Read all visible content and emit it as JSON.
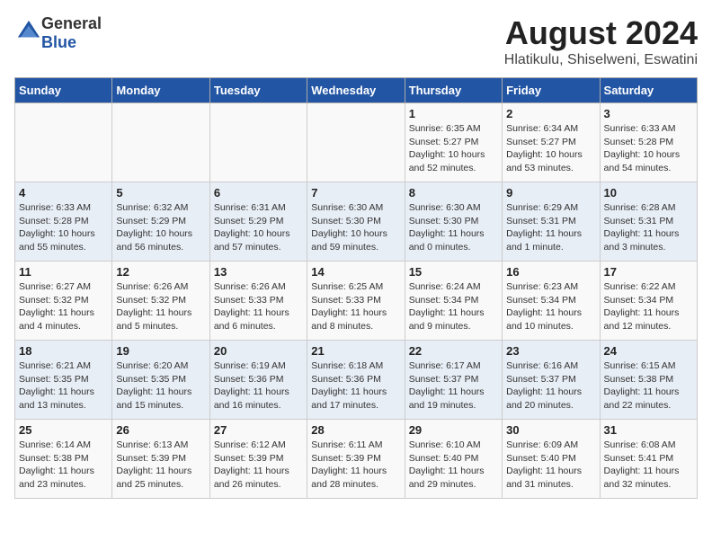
{
  "header": {
    "logo_general": "General",
    "logo_blue": "Blue",
    "title": "August 2024",
    "subtitle": "Hlatikulu, Shiselweni, Eswatini"
  },
  "weekdays": [
    "Sunday",
    "Monday",
    "Tuesday",
    "Wednesday",
    "Thursday",
    "Friday",
    "Saturday"
  ],
  "weeks": [
    [
      {
        "day": "",
        "sunrise": "",
        "sunset": "",
        "daylight": ""
      },
      {
        "day": "",
        "sunrise": "",
        "sunset": "",
        "daylight": ""
      },
      {
        "day": "",
        "sunrise": "",
        "sunset": "",
        "daylight": ""
      },
      {
        "day": "",
        "sunrise": "",
        "sunset": "",
        "daylight": ""
      },
      {
        "day": "1",
        "sunrise": "Sunrise: 6:35 AM",
        "sunset": "Sunset: 5:27 PM",
        "daylight": "Daylight: 10 hours and 52 minutes."
      },
      {
        "day": "2",
        "sunrise": "Sunrise: 6:34 AM",
        "sunset": "Sunset: 5:27 PM",
        "daylight": "Daylight: 10 hours and 53 minutes."
      },
      {
        "day": "3",
        "sunrise": "Sunrise: 6:33 AM",
        "sunset": "Sunset: 5:28 PM",
        "daylight": "Daylight: 10 hours and 54 minutes."
      }
    ],
    [
      {
        "day": "4",
        "sunrise": "Sunrise: 6:33 AM",
        "sunset": "Sunset: 5:28 PM",
        "daylight": "Daylight: 10 hours and 55 minutes."
      },
      {
        "day": "5",
        "sunrise": "Sunrise: 6:32 AM",
        "sunset": "Sunset: 5:29 PM",
        "daylight": "Daylight: 10 hours and 56 minutes."
      },
      {
        "day": "6",
        "sunrise": "Sunrise: 6:31 AM",
        "sunset": "Sunset: 5:29 PM",
        "daylight": "Daylight: 10 hours and 57 minutes."
      },
      {
        "day": "7",
        "sunrise": "Sunrise: 6:30 AM",
        "sunset": "Sunset: 5:30 PM",
        "daylight": "Daylight: 10 hours and 59 minutes."
      },
      {
        "day": "8",
        "sunrise": "Sunrise: 6:30 AM",
        "sunset": "Sunset: 5:30 PM",
        "daylight": "Daylight: 11 hours and 0 minutes."
      },
      {
        "day": "9",
        "sunrise": "Sunrise: 6:29 AM",
        "sunset": "Sunset: 5:31 PM",
        "daylight": "Daylight: 11 hours and 1 minute."
      },
      {
        "day": "10",
        "sunrise": "Sunrise: 6:28 AM",
        "sunset": "Sunset: 5:31 PM",
        "daylight": "Daylight: 11 hours and 3 minutes."
      }
    ],
    [
      {
        "day": "11",
        "sunrise": "Sunrise: 6:27 AM",
        "sunset": "Sunset: 5:32 PM",
        "daylight": "Daylight: 11 hours and 4 minutes."
      },
      {
        "day": "12",
        "sunrise": "Sunrise: 6:26 AM",
        "sunset": "Sunset: 5:32 PM",
        "daylight": "Daylight: 11 hours and 5 minutes."
      },
      {
        "day": "13",
        "sunrise": "Sunrise: 6:26 AM",
        "sunset": "Sunset: 5:33 PM",
        "daylight": "Daylight: 11 hours and 6 minutes."
      },
      {
        "day": "14",
        "sunrise": "Sunrise: 6:25 AM",
        "sunset": "Sunset: 5:33 PM",
        "daylight": "Daylight: 11 hours and 8 minutes."
      },
      {
        "day": "15",
        "sunrise": "Sunrise: 6:24 AM",
        "sunset": "Sunset: 5:34 PM",
        "daylight": "Daylight: 11 hours and 9 minutes."
      },
      {
        "day": "16",
        "sunrise": "Sunrise: 6:23 AM",
        "sunset": "Sunset: 5:34 PM",
        "daylight": "Daylight: 11 hours and 10 minutes."
      },
      {
        "day": "17",
        "sunrise": "Sunrise: 6:22 AM",
        "sunset": "Sunset: 5:34 PM",
        "daylight": "Daylight: 11 hours and 12 minutes."
      }
    ],
    [
      {
        "day": "18",
        "sunrise": "Sunrise: 6:21 AM",
        "sunset": "Sunset: 5:35 PM",
        "daylight": "Daylight: 11 hours and 13 minutes."
      },
      {
        "day": "19",
        "sunrise": "Sunrise: 6:20 AM",
        "sunset": "Sunset: 5:35 PM",
        "daylight": "Daylight: 11 hours and 15 minutes."
      },
      {
        "day": "20",
        "sunrise": "Sunrise: 6:19 AM",
        "sunset": "Sunset: 5:36 PM",
        "daylight": "Daylight: 11 hours and 16 minutes."
      },
      {
        "day": "21",
        "sunrise": "Sunrise: 6:18 AM",
        "sunset": "Sunset: 5:36 PM",
        "daylight": "Daylight: 11 hours and 17 minutes."
      },
      {
        "day": "22",
        "sunrise": "Sunrise: 6:17 AM",
        "sunset": "Sunset: 5:37 PM",
        "daylight": "Daylight: 11 hours and 19 minutes."
      },
      {
        "day": "23",
        "sunrise": "Sunrise: 6:16 AM",
        "sunset": "Sunset: 5:37 PM",
        "daylight": "Daylight: 11 hours and 20 minutes."
      },
      {
        "day": "24",
        "sunrise": "Sunrise: 6:15 AM",
        "sunset": "Sunset: 5:38 PM",
        "daylight": "Daylight: 11 hours and 22 minutes."
      }
    ],
    [
      {
        "day": "25",
        "sunrise": "Sunrise: 6:14 AM",
        "sunset": "Sunset: 5:38 PM",
        "daylight": "Daylight: 11 hours and 23 minutes."
      },
      {
        "day": "26",
        "sunrise": "Sunrise: 6:13 AM",
        "sunset": "Sunset: 5:39 PM",
        "daylight": "Daylight: 11 hours and 25 minutes."
      },
      {
        "day": "27",
        "sunrise": "Sunrise: 6:12 AM",
        "sunset": "Sunset: 5:39 PM",
        "daylight": "Daylight: 11 hours and 26 minutes."
      },
      {
        "day": "28",
        "sunrise": "Sunrise: 6:11 AM",
        "sunset": "Sunset: 5:39 PM",
        "daylight": "Daylight: 11 hours and 28 minutes."
      },
      {
        "day": "29",
        "sunrise": "Sunrise: 6:10 AM",
        "sunset": "Sunset: 5:40 PM",
        "daylight": "Daylight: 11 hours and 29 minutes."
      },
      {
        "day": "30",
        "sunrise": "Sunrise: 6:09 AM",
        "sunset": "Sunset: 5:40 PM",
        "daylight": "Daylight: 11 hours and 31 minutes."
      },
      {
        "day": "31",
        "sunrise": "Sunrise: 6:08 AM",
        "sunset": "Sunset: 5:41 PM",
        "daylight": "Daylight: 11 hours and 32 minutes."
      }
    ]
  ]
}
